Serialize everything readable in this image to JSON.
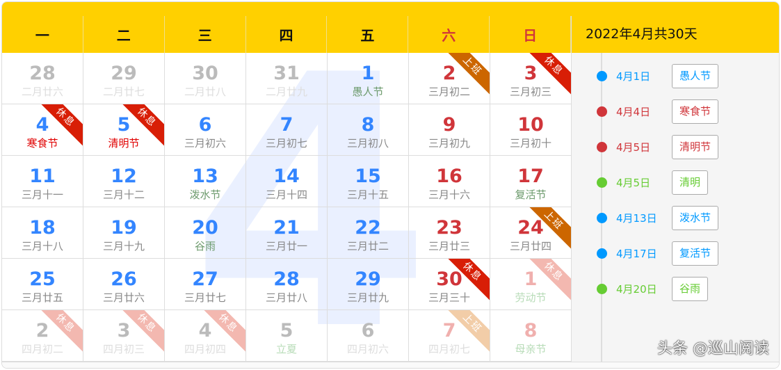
{
  "weekdays": [
    {
      "label": "一",
      "we": false
    },
    {
      "label": "二",
      "we": false
    },
    {
      "label": "三",
      "we": false
    },
    {
      "label": "四",
      "we": false
    },
    {
      "label": "五",
      "we": false
    },
    {
      "label": "六",
      "we": true
    },
    {
      "label": "日",
      "we": true
    }
  ],
  "month_watermark": "4",
  "side_title": "2022年4月共30天",
  "events": [
    {
      "date": "4月1日",
      "name": "愚人节",
      "color": "#0099ff"
    },
    {
      "date": "4月4日",
      "name": "寒食节",
      "color": "#d0353a"
    },
    {
      "date": "4月5日",
      "name": "清明节",
      "color": "#d0353a"
    },
    {
      "date": "4月5日",
      "name": "清明",
      "color": "#66cc33"
    },
    {
      "date": "4月13日",
      "name": "泼水节",
      "color": "#0099ff"
    },
    {
      "date": "4月17日",
      "name": "复活节",
      "color": "#0099ff"
    },
    {
      "date": "4月20日",
      "name": "谷雨",
      "color": "#66cc33"
    }
  ],
  "watermark": "头条 @巡山阅读",
  "days": [
    {
      "n": "28",
      "l": "二月廿六",
      "o": 1
    },
    {
      "n": "29",
      "l": "二月廿七",
      "o": 1
    },
    {
      "n": "30",
      "l": "二月廿八",
      "o": 1
    },
    {
      "n": "31",
      "l": "二月廿九",
      "o": 1
    },
    {
      "n": "1",
      "l": "愚人节",
      "f": 1
    },
    {
      "n": "2",
      "l": "三月初二",
      "w": 1,
      "b": "上班"
    },
    {
      "n": "3",
      "l": "三月初三",
      "w": 1,
      "b": "休息"
    },
    {
      "n": "4",
      "l": "寒食节",
      "h": 1,
      "b": "休息"
    },
    {
      "n": "5",
      "l": "清明节",
      "h": 1,
      "b": "休息"
    },
    {
      "n": "6",
      "l": "三月初六"
    },
    {
      "n": "7",
      "l": "三月初七"
    },
    {
      "n": "8",
      "l": "三月初八"
    },
    {
      "n": "9",
      "l": "三月初九",
      "w": 1
    },
    {
      "n": "10",
      "l": "三月初十",
      "w": 1
    },
    {
      "n": "11",
      "l": "三月十一"
    },
    {
      "n": "12",
      "l": "三月十二"
    },
    {
      "n": "13",
      "l": "泼水节",
      "f": 1
    },
    {
      "n": "14",
      "l": "三月十四"
    },
    {
      "n": "15",
      "l": "三月十五"
    },
    {
      "n": "16",
      "l": "三月十六",
      "w": 1
    },
    {
      "n": "17",
      "l": "复活节",
      "w": 1,
      "f": 1
    },
    {
      "n": "18",
      "l": "三月十八"
    },
    {
      "n": "19",
      "l": "三月十九"
    },
    {
      "n": "20",
      "l": "谷雨",
      "f": 1
    },
    {
      "n": "21",
      "l": "三月廿一"
    },
    {
      "n": "22",
      "l": "三月廿二"
    },
    {
      "n": "23",
      "l": "三月廿三",
      "w": 1
    },
    {
      "n": "24",
      "l": "三月廿四",
      "w": 1,
      "b": "上班"
    },
    {
      "n": "25",
      "l": "三月廿五"
    },
    {
      "n": "26",
      "l": "三月廿六"
    },
    {
      "n": "27",
      "l": "三月廿七"
    },
    {
      "n": "28",
      "l": "三月廿八"
    },
    {
      "n": "29",
      "l": "三月廿九"
    },
    {
      "n": "30",
      "l": "三月三十",
      "w": 1,
      "b": "休息"
    },
    {
      "n": "1",
      "l": "劳动节",
      "o": 1,
      "w": 1,
      "f": 1,
      "b": "休息"
    },
    {
      "n": "2",
      "l": "四月初二",
      "o": 1,
      "b": "休息"
    },
    {
      "n": "3",
      "l": "四月初三",
      "o": 1,
      "b": "休息"
    },
    {
      "n": "4",
      "l": "四月初四",
      "o": 1,
      "b": "休息"
    },
    {
      "n": "5",
      "l": "立夏",
      "o": 1,
      "f": 1
    },
    {
      "n": "6",
      "l": "四月初六",
      "o": 1
    },
    {
      "n": "7",
      "l": "四月初七",
      "o": 1,
      "w": 1,
      "b": "上班"
    },
    {
      "n": "8",
      "l": "母亲节",
      "o": 1,
      "w": 1,
      "f": 1
    }
  ]
}
